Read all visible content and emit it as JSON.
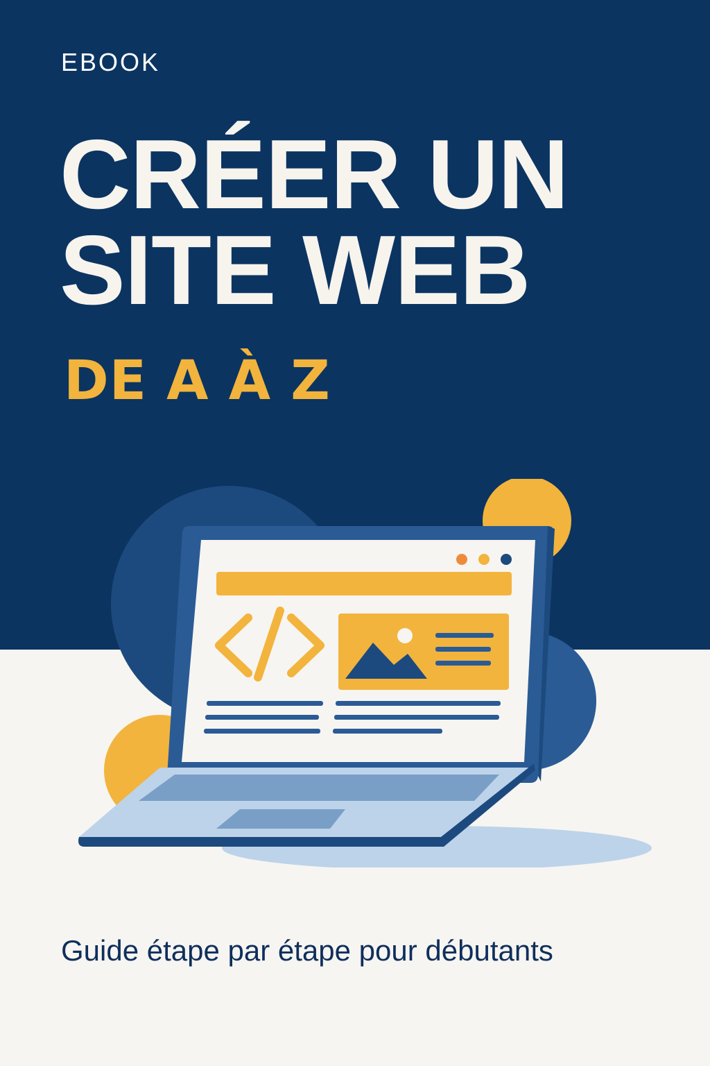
{
  "cover": {
    "label": "EBOOK",
    "title_line_1": "CRÉER UN",
    "title_line_2": "SITE WEB",
    "subtitle": "DE A À Z",
    "tagline": "Guide étape par étape pour débutants"
  },
  "illustration": {
    "icons": [
      "laptop-icon",
      "code-icon",
      "image-icon",
      "browser-window-icon"
    ]
  },
  "colors": {
    "primary": "#0b3461",
    "accent": "#f2b43d",
    "background": "#f7f5f1",
    "title_text": "#f7f4ee"
  }
}
